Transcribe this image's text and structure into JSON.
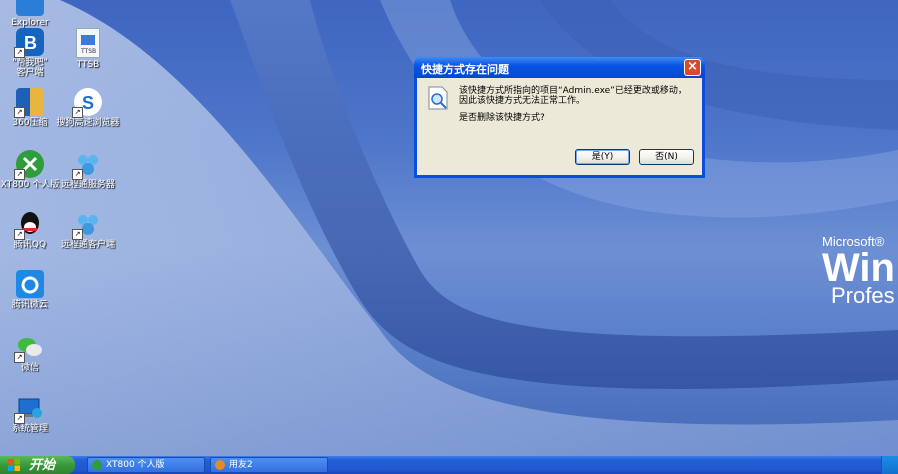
{
  "desktop": {
    "icons": [
      {
        "label": "Explorer",
        "icon": "internet-explorer-icon"
      },
      {
        "label": "\"帮我吧\"\n客户端",
        "icon": "bangwoba-client-icon"
      },
      {
        "label": "360压缩",
        "icon": "360-compress-icon"
      },
      {
        "label": "XT800 个人版",
        "icon": "xt800-personal-icon"
      },
      {
        "label": "腾讯QQ",
        "icon": "tencent-qq-icon"
      },
      {
        "label": "腾讯微云",
        "icon": "tencent-weiyun-icon"
      },
      {
        "label": "微信",
        "icon": "wechat-icon"
      },
      {
        "label": "系统管理",
        "icon": "system-management-icon"
      },
      {
        "label": "TTSB",
        "icon": "ttsb-file-icon"
      },
      {
        "label": "搜狗高速浏览器",
        "icon": "sogou-browser-icon"
      },
      {
        "label": "远程通服务器",
        "icon": "remote-server-icon"
      },
      {
        "label": "远程通客户端",
        "icon": "remote-client-icon"
      }
    ],
    "brand": {
      "line1": "Microsoft®",
      "line2": "Win",
      "line3": "Profes"
    }
  },
  "dialog": {
    "title": "快捷方式存在问题",
    "close_label": "×",
    "message_line1": "该快捷方式所指向的项目“Admin.exe”已经更改或移动，",
    "message_line2": "因此该快捷方式无法正常工作。",
    "question": "是否删除该快捷方式?",
    "yes_label": "是(Y)",
    "no_label": "否(N)"
  },
  "taskbar": {
    "start_label": "开始",
    "tasks": [
      {
        "label": "XT800 个人版",
        "icon": "xt800-task-icon"
      },
      {
        "label": "用友2",
        "icon": "yonyou-task-icon"
      }
    ]
  },
  "colors": {
    "titlebar": "#0a55e3",
    "dialog_body": "#ece9d8",
    "start_button": "#3a9a3a",
    "taskbar": "#2460d8"
  }
}
